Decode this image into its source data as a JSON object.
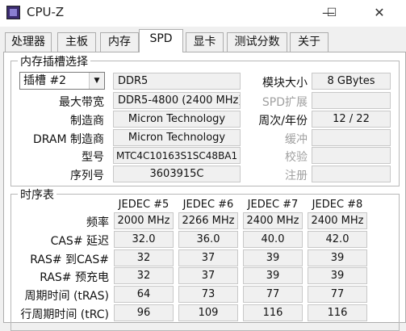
{
  "window": {
    "title": "CPU-Z",
    "minimize": "—",
    "maximize": "☐",
    "close": "✕"
  },
  "tabs": [
    "处理器",
    "主板",
    "内存",
    "SPD",
    "显卡",
    "测试分数",
    "关于"
  ],
  "slot_group": {
    "title": "内存插槽选择",
    "slot_select": "插槽 #2",
    "memory_type": "DDR5",
    "module_size_label": "模块大小",
    "module_size": "8 GBytes",
    "max_bandwidth_label": "最大带宽",
    "max_bandwidth": "DDR5-4800 (2400 MHz)",
    "spd_ext_label": "SPD扩展",
    "spd_ext": "",
    "manufacturer_label": "制造商",
    "manufacturer": "Micron Technology",
    "week_year_label": "周次/年份",
    "week_year": "12 / 22",
    "dram_manufacturer_label": "DRAM 制造商",
    "dram_manufacturer": "Micron Technology",
    "buffer_label": "缓冲",
    "buffer": "",
    "model_label": "型号",
    "model": "MTC4C10163S1SC48BA1",
    "checksum_label": "校验",
    "checksum": "",
    "serial_label": "序列号",
    "serial": "3603915C",
    "registered_label": "注册",
    "registered": ""
  },
  "timing_group": {
    "title": "时序表",
    "columns": [
      "JEDEC #5",
      "JEDEC #6",
      "JEDEC #7",
      "JEDEC #8"
    ],
    "rows": [
      {
        "label": "频率",
        "values": [
          "2000 MHz",
          "2266 MHz",
          "2400 MHz",
          "2400 MHz"
        ]
      },
      {
        "label": "CAS# 延迟",
        "values": [
          "32.0",
          "36.0",
          "40.0",
          "42.0"
        ]
      },
      {
        "label": "RAS# 到CAS#",
        "values": [
          "32",
          "37",
          "39",
          "39"
        ]
      },
      {
        "label": "RAS# 预充电",
        "values": [
          "32",
          "37",
          "39",
          "39"
        ]
      },
      {
        "label": "周期时间 (tRAS)",
        "values": [
          "64",
          "73",
          "77",
          "77"
        ]
      },
      {
        "label": "行周期时间 (tRC)",
        "values": [
          "96",
          "109",
          "116",
          "116"
        ]
      }
    ]
  }
}
